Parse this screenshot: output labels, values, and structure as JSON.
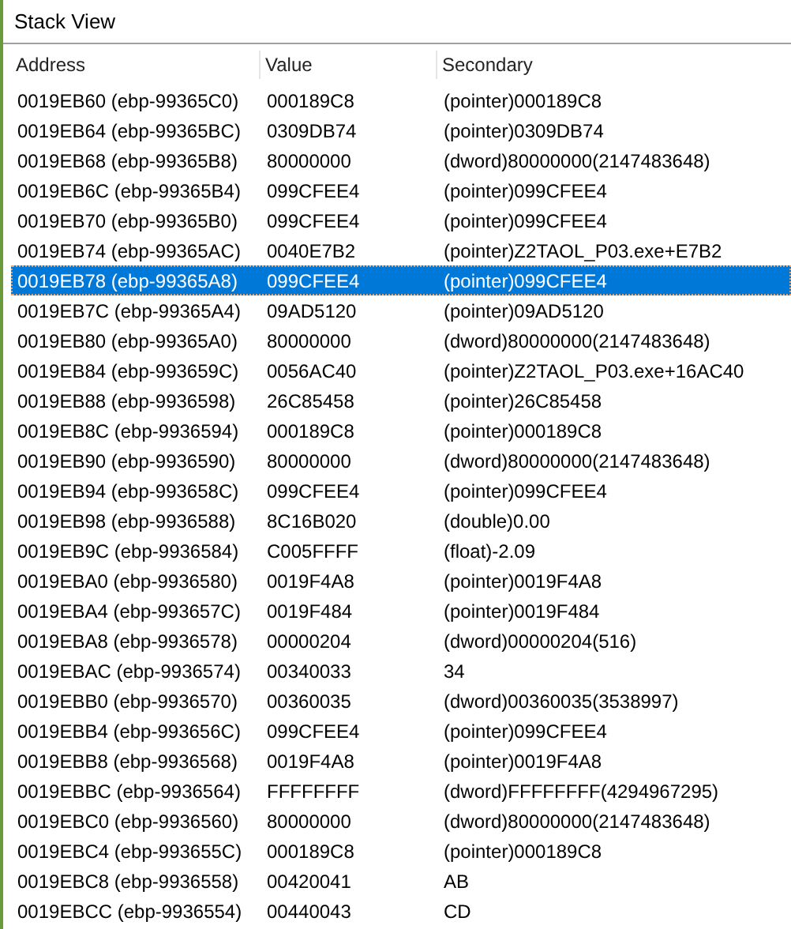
{
  "window": {
    "title": "Stack View"
  },
  "table": {
    "columns": [
      "Address",
      "Value",
      "Secondary"
    ],
    "rows": [
      {
        "address": "0019EB60 (ebp-99365C0)",
        "value": "000189C8",
        "secondary": "(pointer)000189C8",
        "selected": false
      },
      {
        "address": "0019EB64 (ebp-99365BC)",
        "value": "0309DB74",
        "secondary": "(pointer)0309DB74",
        "selected": false
      },
      {
        "address": "0019EB68 (ebp-99365B8)",
        "value": "80000000",
        "secondary": "(dword)80000000(2147483648)",
        "selected": false
      },
      {
        "address": "0019EB6C (ebp-99365B4)",
        "value": "099CFEE4",
        "secondary": "(pointer)099CFEE4",
        "selected": false
      },
      {
        "address": "0019EB70 (ebp-99365B0)",
        "value": "099CFEE4",
        "secondary": "(pointer)099CFEE4",
        "selected": false
      },
      {
        "address": "0019EB74 (ebp-99365AC)",
        "value": "0040E7B2",
        "secondary": "(pointer)Z2TAOL_P03.exe+E7B2",
        "selected": false
      },
      {
        "address": "0019EB78 (ebp-99365A8)",
        "value": "099CFEE4",
        "secondary": "(pointer)099CFEE4",
        "selected": true
      },
      {
        "address": "0019EB7C (ebp-99365A4)",
        "value": "09AD5120",
        "secondary": "(pointer)09AD5120",
        "selected": false
      },
      {
        "address": "0019EB80 (ebp-99365A0)",
        "value": "80000000",
        "secondary": "(dword)80000000(2147483648)",
        "selected": false
      },
      {
        "address": "0019EB84 (ebp-993659C)",
        "value": "0056AC40",
        "secondary": "(pointer)Z2TAOL_P03.exe+16AC40",
        "selected": false
      },
      {
        "address": "0019EB88 (ebp-9936598)",
        "value": "26C85458",
        "secondary": "(pointer)26C85458",
        "selected": false
      },
      {
        "address": "0019EB8C (ebp-9936594)",
        "value": "000189C8",
        "secondary": "(pointer)000189C8",
        "selected": false
      },
      {
        "address": "0019EB90 (ebp-9936590)",
        "value": "80000000",
        "secondary": "(dword)80000000(2147483648)",
        "selected": false
      },
      {
        "address": "0019EB94 (ebp-993658C)",
        "value": "099CFEE4",
        "secondary": "(pointer)099CFEE4",
        "selected": false
      },
      {
        "address": "0019EB98 (ebp-9936588)",
        "value": "8C16B020",
        "secondary": "(double)0.00",
        "selected": false
      },
      {
        "address": "0019EB9C (ebp-9936584)",
        "value": "C005FFFF",
        "secondary": "(float)-2.09",
        "selected": false
      },
      {
        "address": "0019EBA0 (ebp-9936580)",
        "value": "0019F4A8",
        "secondary": "(pointer)0019F4A8",
        "selected": false
      },
      {
        "address": "0019EBA4 (ebp-993657C)",
        "value": "0019F484",
        "secondary": "(pointer)0019F484",
        "selected": false
      },
      {
        "address": "0019EBA8 (ebp-9936578)",
        "value": "00000204",
        "secondary": "(dword)00000204(516)",
        "selected": false
      },
      {
        "address": "0019EBAC (ebp-9936574)",
        "value": "00340033",
        "secondary": "34",
        "selected": false
      },
      {
        "address": "0019EBB0 (ebp-9936570)",
        "value": "00360035",
        "secondary": "(dword)00360035(3538997)",
        "selected": false
      },
      {
        "address": "0019EBB4 (ebp-993656C)",
        "value": "099CFEE4",
        "secondary": "(pointer)099CFEE4",
        "selected": false
      },
      {
        "address": "0019EBB8 (ebp-9936568)",
        "value": "0019F4A8",
        "secondary": "(pointer)0019F4A8",
        "selected": false
      },
      {
        "address": "0019EBBC (ebp-9936564)",
        "value": "FFFFFFFF",
        "secondary": "(dword)FFFFFFFF(4294967295)",
        "selected": false
      },
      {
        "address": "0019EBC0 (ebp-9936560)",
        "value": "80000000",
        "secondary": "(dword)80000000(2147483648)",
        "selected": false
      },
      {
        "address": "0019EBC4 (ebp-993655C)",
        "value": "000189C8",
        "secondary": "(pointer)000189C8",
        "selected": false
      },
      {
        "address": "0019EBC8 (ebp-9936558)",
        "value": "00420041",
        "secondary": "AB",
        "selected": false
      },
      {
        "address": "0019EBCC (ebp-9936554)",
        "value": "00440043",
        "secondary": "CD",
        "selected": false
      }
    ]
  }
}
